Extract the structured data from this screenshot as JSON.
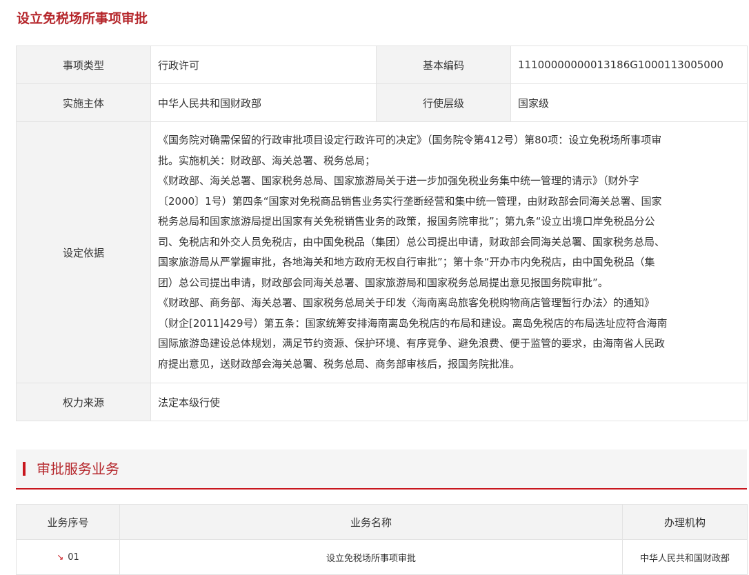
{
  "page": {
    "title": "设立免税场所事项审批"
  },
  "info": {
    "row1": {
      "label1": "事项类型",
      "value1": "行政许可",
      "label2": "基本编码",
      "value2": "11100000000013186G1000113005000"
    },
    "row2": {
      "label1": "实施主体",
      "value1": "中华人民共和国财政部",
      "label2": "行使层级",
      "value2": "国家级"
    },
    "basis": {
      "label": "设定依据",
      "lines": [
        "《国务院对确需保留的行政审批项目设定行政许可的决定》（国务院令第412号）第80项：设立免税场所事项审",
        "批。实施机关：财政部、海关总署、税务总局；",
        "《财政部、海关总署、国家税务总局、国家旅游局关于进一步加强免税业务集中统一管理的请示》（财外字",
        "〔2000〕1号）第四条“国家对免税商品销售业务实行垄断经营和集中统一管理，由财政部会同海关总署、国家",
        "税务总局和国家旅游局提出国家有关免税销售业务的政策，报国务院审批”；第九条“设立出境口岸免税品分公",
        "司、免税店和外交人员免税店，由中国免税品（集团）总公司提出申请，财政部会同海关总署、国家税务总局、",
        "国家旅游局从严掌握审批，各地海关和地方政府无权自行审批”；第十条“开办市内免税店，由中国免税品（集",
        "团）总公司提出申请，财政部会同海关总署、国家旅游局和国家税务总局提出意见报国务院审批”。",
        "《财政部、商务部、海关总署、国家税务总局关于印发〈海南离岛旅客免税购物商店管理暂行办法〉的通知》",
        "（财企[2011]429号）第五条：国家统筹安排海南离岛免税店的布局和建设。离岛免税店的布局选址应符合海南",
        "国际旅游岛建设总体规划，满足节约资源、保护环境、有序竞争、避免浪费、便于监管的要求，由海南省人民政",
        "府提出意见，送财政部会海关总署、税务总局、商务部审核后，报国务院批准。"
      ]
    },
    "authority": {
      "label": "权力来源",
      "value": "法定本级行使"
    }
  },
  "services": {
    "section_title": "审批服务业务",
    "headers": [
      "业务序号",
      "业务名称",
      "办理机构"
    ],
    "rows": [
      {
        "index": "01",
        "name": "设立免税场所事项审批",
        "agency": "中华人民共和国财政部"
      }
    ]
  }
}
